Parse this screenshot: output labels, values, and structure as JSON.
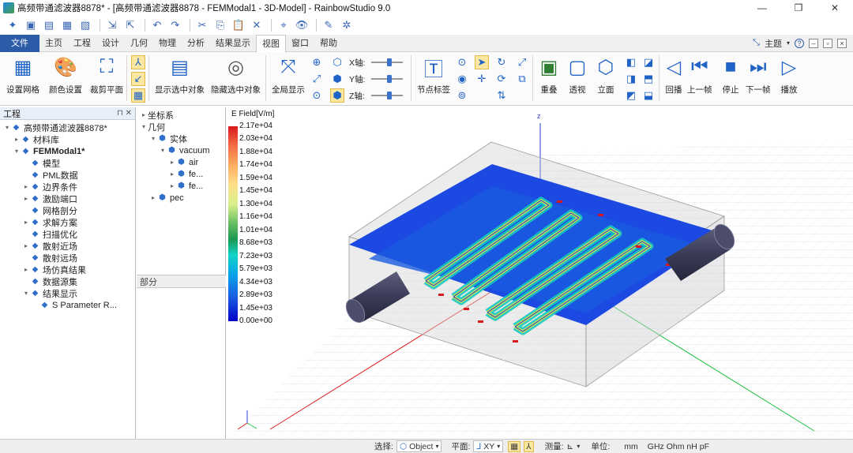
{
  "window": {
    "title": "高频带通滤波器8878* - [高频带通滤波器8878 - FEMModal1 - 3D-Model] - RainbowStudio 9.0",
    "minimize": "—",
    "restore": "❐",
    "close": "✕"
  },
  "menu": {
    "file": "文件",
    "tabs": [
      "主页",
      "工程",
      "设计",
      "几何",
      "物理",
      "分析",
      "结果显示",
      "视图",
      "窗口",
      "帮助"
    ],
    "active_index": 7,
    "theme_label": "主题",
    "help": "?"
  },
  "ribbon": {
    "buttons": [
      {
        "label": "设置网格",
        "icon": "grid-icon"
      },
      {
        "label": "颜色设置",
        "icon": "palette-icon"
      },
      {
        "label": "裁剪平面",
        "icon": "crop-icon"
      },
      {
        "label": "显示选中对象",
        "icon": "show-selected-icon"
      },
      {
        "label": "隐藏选中对象",
        "icon": "hide-selected-icon"
      },
      {
        "label": "全局显示",
        "icon": "fit-all-icon"
      },
      {
        "label": "节点标签",
        "icon": "node-label-icon"
      },
      {
        "label": "重叠",
        "icon": "overlap-icon"
      },
      {
        "label": "透视",
        "icon": "perspective-icon"
      },
      {
        "label": "立面",
        "icon": "elevation-icon"
      },
      {
        "label": "回播",
        "icon": "rewind-icon"
      },
      {
        "label": "上一帧",
        "icon": "prev-frame-icon"
      },
      {
        "label": "停止",
        "icon": "stop-icon"
      },
      {
        "label": "下一帧",
        "icon": "next-frame-icon"
      },
      {
        "label": "播放",
        "icon": "play-icon"
      }
    ],
    "axis_labels": {
      "x": "X轴:",
      "y": "Y轴:",
      "z": "Z轴:"
    }
  },
  "left_panel": {
    "header": "工程",
    "tree": [
      {
        "label": "高频带通滤波器8878*",
        "level": 0,
        "bold": false,
        "icon": "project-icon",
        "arrow": "▾"
      },
      {
        "label": "材料库",
        "level": 1,
        "icon": "material-icon",
        "arrow": "▸"
      },
      {
        "label": "FEMModal1*",
        "level": 1,
        "bold": true,
        "icon": "gear-icon",
        "arrow": "▾"
      },
      {
        "label": "模型",
        "level": 2,
        "icon": "model-icon",
        "arrow": ""
      },
      {
        "label": "PML数据",
        "level": 2,
        "icon": "pml-icon",
        "arrow": ""
      },
      {
        "label": "边界条件",
        "level": 2,
        "icon": "boundary-icon",
        "arrow": "▸"
      },
      {
        "label": "激励端口",
        "level": 2,
        "icon": "port-icon",
        "arrow": "▸"
      },
      {
        "label": "网格剖分",
        "level": 2,
        "icon": "mesh-icon",
        "arrow": ""
      },
      {
        "label": "求解方案",
        "level": 2,
        "icon": "solve-icon",
        "arrow": "▸"
      },
      {
        "label": "扫描优化",
        "level": 2,
        "icon": "sweep-icon",
        "arrow": ""
      },
      {
        "label": "散射近场",
        "level": 2,
        "icon": "near-field-icon",
        "arrow": "▸"
      },
      {
        "label": "散射远场",
        "level": 2,
        "icon": "far-field-icon",
        "arrow": ""
      },
      {
        "label": "场仿真结果",
        "level": 2,
        "icon": "field-result-icon",
        "arrow": "▸"
      },
      {
        "label": "数据源集",
        "level": 2,
        "icon": "dataset-icon",
        "arrow": ""
      },
      {
        "label": "结果显示",
        "level": 2,
        "icon": "result-icon",
        "arrow": "▾"
      },
      {
        "label": "S Parameter R...",
        "level": 3,
        "icon": "chart-icon",
        "arrow": ""
      }
    ]
  },
  "mid_panel": {
    "tree": [
      {
        "label": "坐标系",
        "level": 0,
        "arrow": "▸",
        "icon": ""
      },
      {
        "label": "几何",
        "level": 0,
        "arrow": "▾",
        "icon": ""
      },
      {
        "label": "实体",
        "level": 1,
        "arrow": "▾",
        "icon": "solid-icon"
      },
      {
        "label": "vacuum",
        "level": 2,
        "arrow": "▾",
        "icon": "material-icon"
      },
      {
        "label": "air",
        "level": 3,
        "arrow": "▸",
        "icon": "solid-icon"
      },
      {
        "label": "fe...",
        "level": 3,
        "arrow": "▸",
        "icon": "solid-icon"
      },
      {
        "label": "fe...",
        "level": 3,
        "arrow": "▸",
        "icon": "solid-icon"
      },
      {
        "label": "pec",
        "level": 1,
        "arrow": "▸",
        "icon": "material-icon"
      }
    ],
    "sub_header": "部分"
  },
  "legend": {
    "title": "E Field[V/m]",
    "ticks": [
      "2.17e+04",
      "2.03e+04",
      "1.88e+04",
      "1.74e+04",
      "1.59e+04",
      "1.45e+04",
      "1.30e+04",
      "1.16e+04",
      "1.01e+04",
      "8.68e+03",
      "7.23e+03",
      "5.79e+03",
      "4.34e+03",
      "2.89e+03",
      "1.45e+03",
      "0.00e+00"
    ]
  },
  "viewport": {
    "axis_z": "z",
    "axis_x": "x",
    "axis_y": "y",
    "colors": {
      "axis_z": "#2a3fe0",
      "axis_x": "#e02020",
      "axis_y": "#20c040",
      "box_edge": "#9a9a9a",
      "coax": "#3a3c57"
    }
  },
  "status": {
    "select_label": "选择:",
    "select_value": "Object",
    "plane_label": "平面:",
    "plane_value": "XY",
    "measure_label": "测量:",
    "unit_label": "单位:",
    "unit_value": "mm",
    "unit_extra": "GHz Ohm nH pF"
  }
}
